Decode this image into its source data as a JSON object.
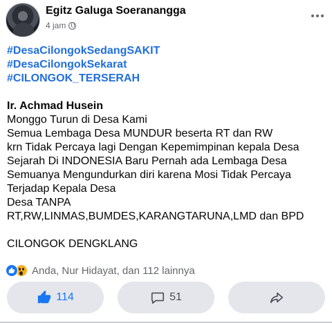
{
  "post": {
    "author": "Egitz Galuga Soeranangga",
    "time": "4 jam",
    "hashtags": [
      "#DesaCilongokSedangSAKIT",
      "#DesaCilongokSekarat",
      "#CILONGOK_TERSERAH"
    ],
    "heading": "Ir. Achmad Husein",
    "lines": [
      "Monggo Turun di Desa Kami",
      "Semua Lembaga Desa MUNDUR beserta RT dan RW",
      "krn Tidak Percaya lagi Dengan Kepemimpinan kepala Desa",
      "Sejarah Di INDONESIA Baru Pernah ada Lembaga Desa",
      "Semuanya Mengundurkan diri karena Mosi Tidak Percaya",
      "Terjadap Kepala Desa",
      "Desa TANPA",
      "RT,RW,LINMAS,BUMDES,KARANGTARUNA,LMD dan BPD"
    ],
    "closing": "CILONGOK DENGKLANG"
  },
  "reactions": {
    "icons": [
      "like-icon",
      "wow-icon"
    ],
    "summary": "Anda, Nur Hidayat, dan 112 lainnya"
  },
  "actions": {
    "like_count": "114",
    "comment_count": "51",
    "icons": [
      "thumbs-up-icon",
      "comment-icon",
      "share-icon"
    ]
  },
  "colors": {
    "accent": "#1877f2",
    "hashtag": "#216fdb",
    "button_bg": "#e4e6eb",
    "secondary_text": "#65676b"
  }
}
